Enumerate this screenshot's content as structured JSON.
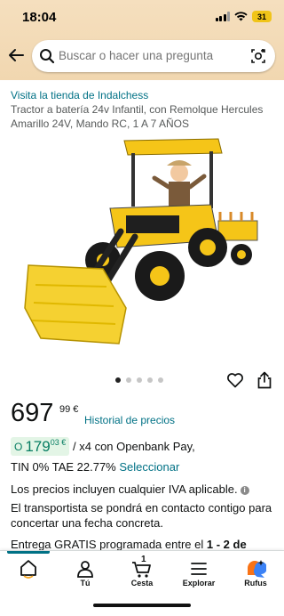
{
  "status": {
    "time": "18:04",
    "battery": "31"
  },
  "search": {
    "placeholder": "Buscar o hacer una pregunta"
  },
  "product": {
    "store_link": "Visita la tienda de Indalchess",
    "title": "Tractor a batería 24v Infantil, con Remolque Hercules Amarillo 24V, Mando RC, 1 A 7 AÑOS",
    "image_alt": "Tractor eléctrico infantil amarillo con pala y remolque",
    "carousel": {
      "total": 5,
      "active": 1
    }
  },
  "price": {
    "whole": "697",
    "fraction": "99 €",
    "history_link": "Historial de precios"
  },
  "financing": {
    "prefix": "O",
    "whole": "179",
    "fraction": "03 €",
    "text": "/ x4 con Openbank Pay,",
    "line2": "TIN 0% TAE 22.77%",
    "select_link": "Seleccionar"
  },
  "vat_note": "Los precios incluyen cualquier IVA aplicable.",
  "carrier_note": "El transportista se pondrá en contacto contigo para concertar una fecha concreta.",
  "delivery": {
    "prefix": "Entrega GRATIS programada entre el ",
    "bold": "1 - 2 de"
  },
  "nav": {
    "home": "",
    "account": "Tú",
    "cart": "Cesta",
    "cart_count": "1",
    "explore": "Explorar",
    "rufus": "Rufus"
  },
  "colors": {
    "link": "#007185",
    "price_green": "#067d62",
    "accent_yellow": "#f5c518",
    "header_bg": "#f3dab4"
  }
}
